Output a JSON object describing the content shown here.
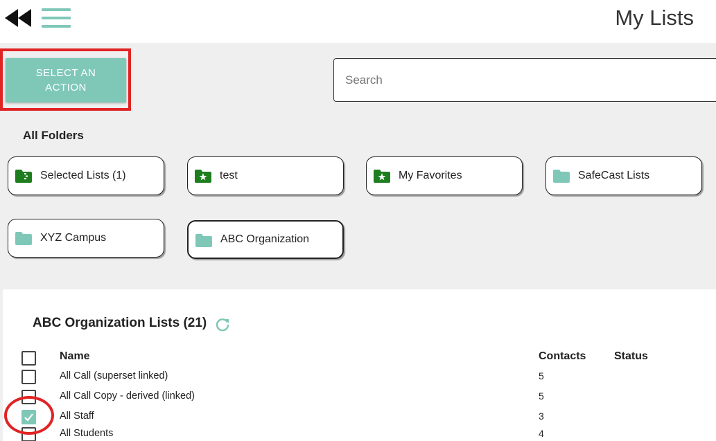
{
  "header": {
    "title": "My Lists",
    "back_icon": "double-chevron-left-icon",
    "menu_icon": "hamburger-menu-icon"
  },
  "toolbar": {
    "action_label_line1": "SELECT AN",
    "action_label_line2": "ACTION"
  },
  "search": {
    "placeholder": "Search",
    "value": ""
  },
  "folders": {
    "heading": "All Folders",
    "items": [
      {
        "label": "Selected Lists (1)",
        "icon": "folder-selected-icon",
        "color": "#1e7d1e"
      },
      {
        "label": "test",
        "icon": "folder-star-icon",
        "color": "#1e7d1e"
      },
      {
        "label": "My Favorites",
        "icon": "folder-star-icon",
        "color": "#1e7d1e"
      },
      {
        "label": "SafeCast Lists",
        "icon": "folder-icon",
        "color": "#7fc8b8"
      },
      {
        "label": "XYZ Campus",
        "icon": "folder-icon",
        "color": "#7fc8b8"
      },
      {
        "label": "ABC Organization",
        "icon": "folder-icon",
        "color": "#7fc8b8",
        "active": true
      }
    ]
  },
  "lists": {
    "title": "ABC Organization Lists (21)",
    "refresh_icon": "refresh-icon",
    "columns": {
      "name": "Name",
      "contacts": "Contacts",
      "status": "Status"
    },
    "rows": [
      {
        "name": "All Call (superset linked)",
        "contacts": "5",
        "checked": false
      },
      {
        "name": "All Call Copy - derived (linked)",
        "contacts": "5",
        "checked": false
      },
      {
        "name": "All Staff",
        "contacts": "3",
        "checked": true
      },
      {
        "name": "All Students",
        "contacts": "4",
        "checked": false
      }
    ]
  },
  "colors": {
    "accent": "#7fc8b8",
    "folder_green": "#1e7d1e",
    "annotation_red": "#e02424"
  }
}
